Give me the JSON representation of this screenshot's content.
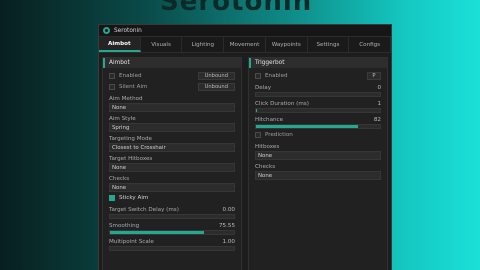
{
  "background": {
    "title_fragment": "Serotonin"
  },
  "window": {
    "title": "Serotonin",
    "accent": "#23a990"
  },
  "tabs": [
    {
      "label": "Aimbot",
      "active": true
    },
    {
      "label": "Visuals"
    },
    {
      "label": "Lighting"
    },
    {
      "label": "Movement"
    },
    {
      "label": "Waypoints"
    },
    {
      "label": "Settings"
    },
    {
      "label": "Configs"
    }
  ],
  "aimbot": {
    "header": "Aimbot",
    "enabled": {
      "label": "Enabled",
      "checked": false,
      "key": "Unbound"
    },
    "silent_aim": {
      "label": "Silent Aim",
      "checked": false,
      "key": "Unbound"
    },
    "aim_method": {
      "label": "Aim Method",
      "value": "None"
    },
    "aim_style": {
      "label": "Aim Style",
      "value": "Spring"
    },
    "targeting_mode": {
      "label": "Targeting Mode",
      "value": "Closest to Crosshair"
    },
    "target_hitboxes": {
      "label": "Target Hitboxes",
      "value": "None"
    },
    "checks": {
      "label": "Checks",
      "value": "None"
    },
    "sticky_aim": {
      "label": "Sticky Aim",
      "checked": true
    },
    "target_switch_delay": {
      "label": "Target Switch Delay (ms)",
      "value": "0.00",
      "fraction": 0
    },
    "smoothing": {
      "label": "Smoothing",
      "value": "75.55",
      "fraction": 0.76
    },
    "multipoint_scale": {
      "label": "Multipoint Scale",
      "value": "1.00",
      "fraction": 0
    }
  },
  "triggerbot": {
    "header": "Triggerbot",
    "enabled": {
      "label": "Enabled",
      "checked": false,
      "key": "P"
    },
    "delay": {
      "label": "Delay",
      "value": "0",
      "fraction": 0
    },
    "click_duration": {
      "label": "Click Duration (ms)",
      "value": "1",
      "fraction": 0.01
    },
    "hitchance": {
      "label": "Hitchance",
      "value": "82",
      "fraction": 0.82
    },
    "prediction": {
      "label": "Prediction",
      "checked": false
    },
    "hitboxes": {
      "label": "Hitboxes",
      "value": "None"
    },
    "checks": {
      "label": "Checks",
      "value": "None"
    }
  }
}
